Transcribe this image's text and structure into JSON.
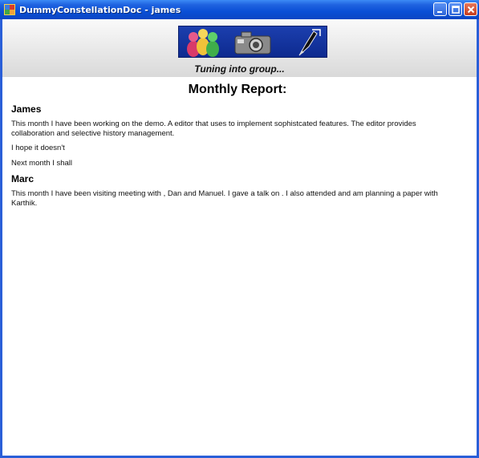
{
  "window": {
    "title": "DummyConstellationDoc - james",
    "controls": [
      {
        "name": "minimize-button",
        "icon": "minimize-icon"
      },
      {
        "name": "maximize-button",
        "icon": "maximize-icon"
      },
      {
        "name": "close-button",
        "icon": "close-icon"
      }
    ],
    "colors": {
      "titlebar": "#0a4fd6",
      "close": "#c63a1c",
      "border": "#2a5fd8"
    }
  },
  "banner": {
    "icons": [
      "group-people-icon",
      "camera-icon",
      "pen-icon"
    ],
    "caption": "Tuning into group..."
  },
  "document": {
    "title": "Monthly Report:",
    "sections": [
      {
        "name": "James",
        "paragraphs": [
          "This month I have been working on the  demo. A  editor that uses  to implement sophistcated features. The editor provides  collaboration and selective history management.",
          "I hope it doesn't",
          "Next month I shall"
        ]
      },
      {
        "name": "Marc",
        "paragraphs": [
          "This month I have been visiting  meeting with  , Dan and Manuel. I gave a talk on  . I also attended  and am planning a paper with  Karthik."
        ]
      }
    ]
  }
}
